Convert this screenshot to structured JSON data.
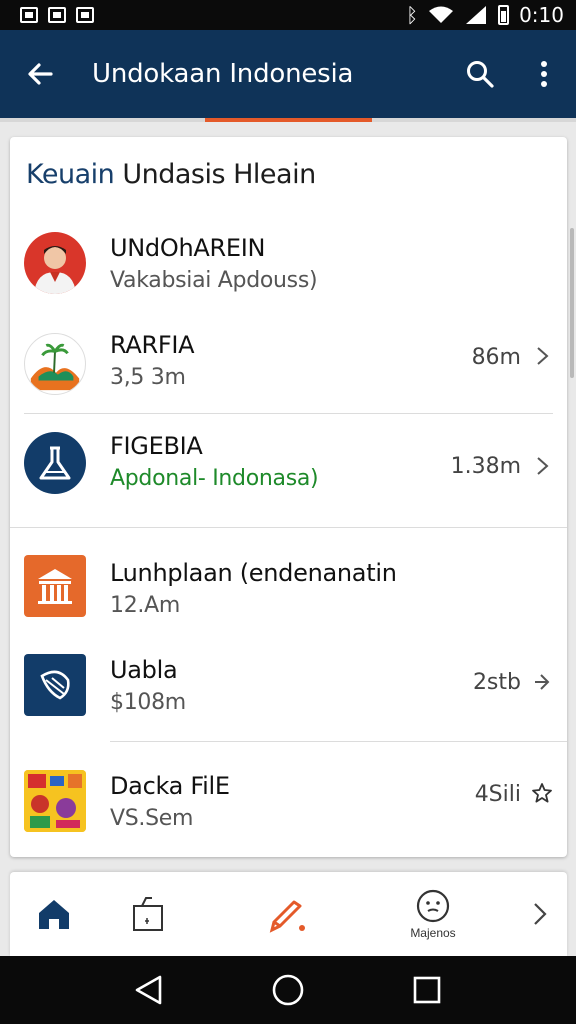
{
  "status_bar": {
    "time": "0:10"
  },
  "app_bar": {
    "title": "Undokaan Indonesia",
    "back_icon": "arrow-left-icon",
    "search_icon": "search-icon",
    "menu_icon": "more-vert-icon"
  },
  "card": {
    "heading_brand": "Keuain",
    "heading_rest": " Undasis Hleain",
    "items": [
      {
        "title": "UNdOhAREIN",
        "subtitle": "Vakabsiai Apdouss)",
        "meta": "",
        "icon": "person-avatar-icon"
      },
      {
        "title": "RARFIA",
        "subtitle": "3,5 3m",
        "meta": "86m",
        "icon": "palm-landscape-icon"
      },
      {
        "title": "FIGEBIA",
        "subtitle": "Apdonal- Indonasa)",
        "meta": "1.38m",
        "icon": "flask-icon"
      },
      {
        "title": "Lunhplaan (endenanatin",
        "subtitle": "12.Am",
        "meta": "",
        "icon": "building-icon"
      },
      {
        "title": "Uabla",
        "subtitle": "$108m",
        "meta": "2stb",
        "icon": "feather-icon"
      },
      {
        "title": "Dacka FilE",
        "subtitle": "VS.Sem",
        "meta": "4Sili",
        "icon": "colorful-thumbnail-icon"
      }
    ]
  },
  "bottom_nav": {
    "items": [
      {
        "label": "",
        "icon": "home-icon"
      },
      {
        "label": "",
        "icon": "bag-icon"
      },
      {
        "label": "",
        "icon": "edit-pencil-icon"
      },
      {
        "label": "Majenos",
        "icon": "face-icon"
      }
    ]
  },
  "colors": {
    "app_bar": "#0f3358",
    "accent": "#e45a2a",
    "green_text": "#1e8a2a"
  }
}
